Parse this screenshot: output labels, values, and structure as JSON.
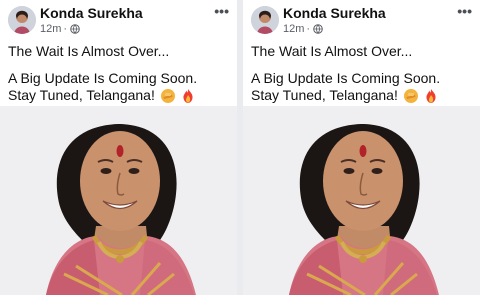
{
  "posts": [
    {
      "author": "Konda Surekha",
      "timestamp": "12m",
      "text_line1": "The Wait Is Almost Over...",
      "text_line2": "A Big Update Is Coming Soon.",
      "text_line3": "Stay Tuned, Telangana!",
      "emojis": [
        "punch-emoji",
        "fire-emoji"
      ],
      "privacy_icon": "globe-icon",
      "more_icon": "more-options-icon"
    },
    {
      "author": "Konda Surekha",
      "timestamp": "12m",
      "text_line1": "The Wait Is Almost Over...",
      "text_line2": "A Big Update Is Coming Soon.",
      "text_line3": "Stay Tuned, Telangana!",
      "emojis": [
        "punch-emoji",
        "fire-emoji"
      ],
      "privacy_icon": "globe-icon",
      "more_icon": "more-options-icon"
    }
  ],
  "colors": {
    "text": "#111111",
    "meta": "#5b5f66",
    "saree_pink": "#d46b7a",
    "skin": "#c9916c",
    "gold": "#c99a3e"
  }
}
